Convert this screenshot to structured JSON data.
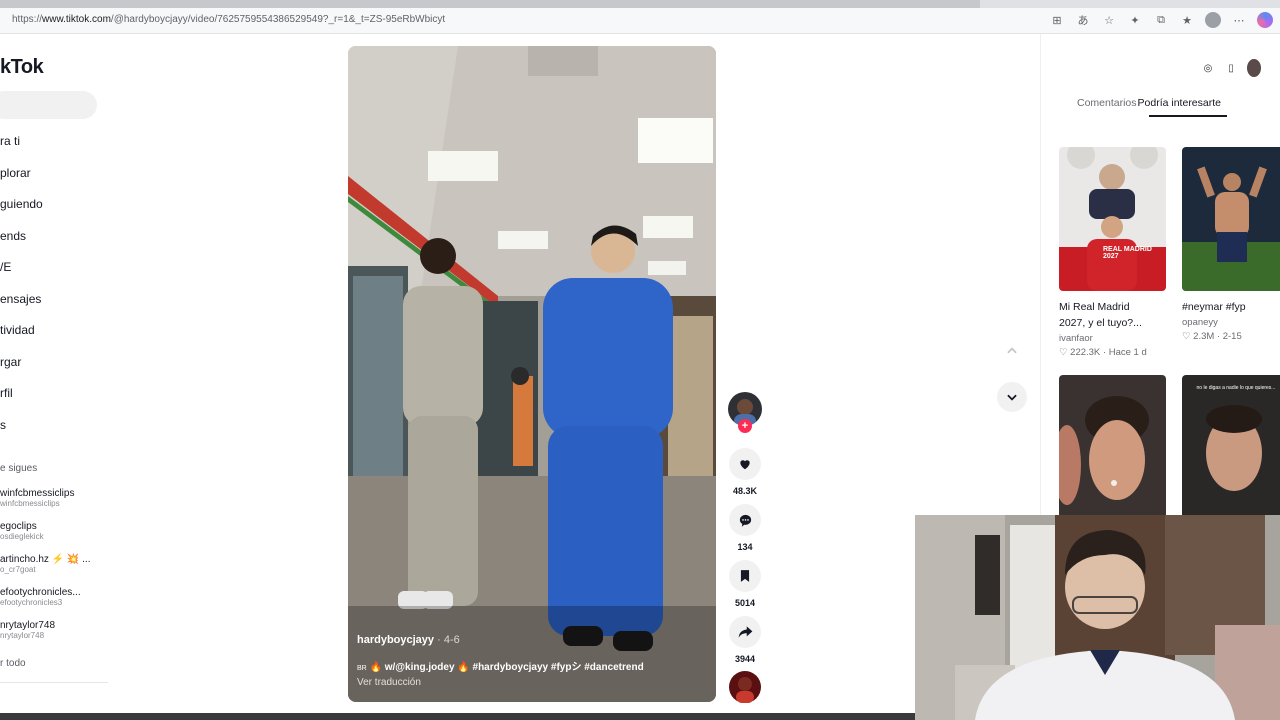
{
  "browser": {
    "url_prefix": "https://",
    "url_host": "www.tiktok.com",
    "url_path": "/@hardyboycjayy/video/7625759554386529549?_r=1&_t=ZS-95eRbWbicyt"
  },
  "sidebar": {
    "logo": "kTok",
    "nav": [
      "ra ti",
      "plorar",
      "guiendo",
      "ends",
      "/E",
      "ensajes",
      "tividad",
      "rgar",
      "rfil",
      "s"
    ],
    "following_title": "e sigues",
    "accounts": [
      {
        "name": "winfcbmessiclips",
        "handle": "winfcbmessiclips"
      },
      {
        "name": "egoclips",
        "handle": "osdieglekick"
      },
      {
        "name": "artincho.hz ⚡ 💥 ...",
        "handle": "o_cr7goat"
      },
      {
        "name": "efootychronicles...",
        "handle": "efootychronicles3"
      },
      {
        "name": "nrytaylor748",
        "handle": "nrytaylor748"
      }
    ],
    "see_all": "r todo"
  },
  "video": {
    "username": "hardyboycjayy",
    "date": " · 4-6",
    "flag": "BR",
    "caption": " 🔥 w/@king.jodey 🔥  #hardyboycjayy #fypシ #dancetrend",
    "translate": "Ver traducción"
  },
  "actions": {
    "likes": "48.3K",
    "comments": "134",
    "saves": "5014",
    "shares": "3944"
  },
  "right_panel": {
    "tabs": [
      "Comentarios",
      "Podría interesarte"
    ],
    "active_tab": 1,
    "cards": [
      {
        "title": "Mi Real Madrid",
        "title2": "2027, y el tuyo?...",
        "user": "ivanfaor",
        "likes": "222.3K",
        "time": " · Hace 1 d",
        "overlay": "REAL MADRID 2027"
      },
      {
        "title": "#neymar #fyp",
        "title2": "",
        "user": "opaneyy",
        "likes": "2.3M",
        "time": " · 2-15",
        "overlay": ""
      },
      {
        "title": "",
        "title2": "",
        "user": "",
        "likes": "",
        "time": "",
        "overlay": ""
      },
      {
        "title": "",
        "title2": "",
        "user": "",
        "likes": "",
        "time": "",
        "overlay": "no le digas a nadie lo que quieres..."
      }
    ]
  },
  "colors": {
    "accent": "#fe2c55",
    "text": "#161823",
    "muted": "#6b6c72"
  }
}
